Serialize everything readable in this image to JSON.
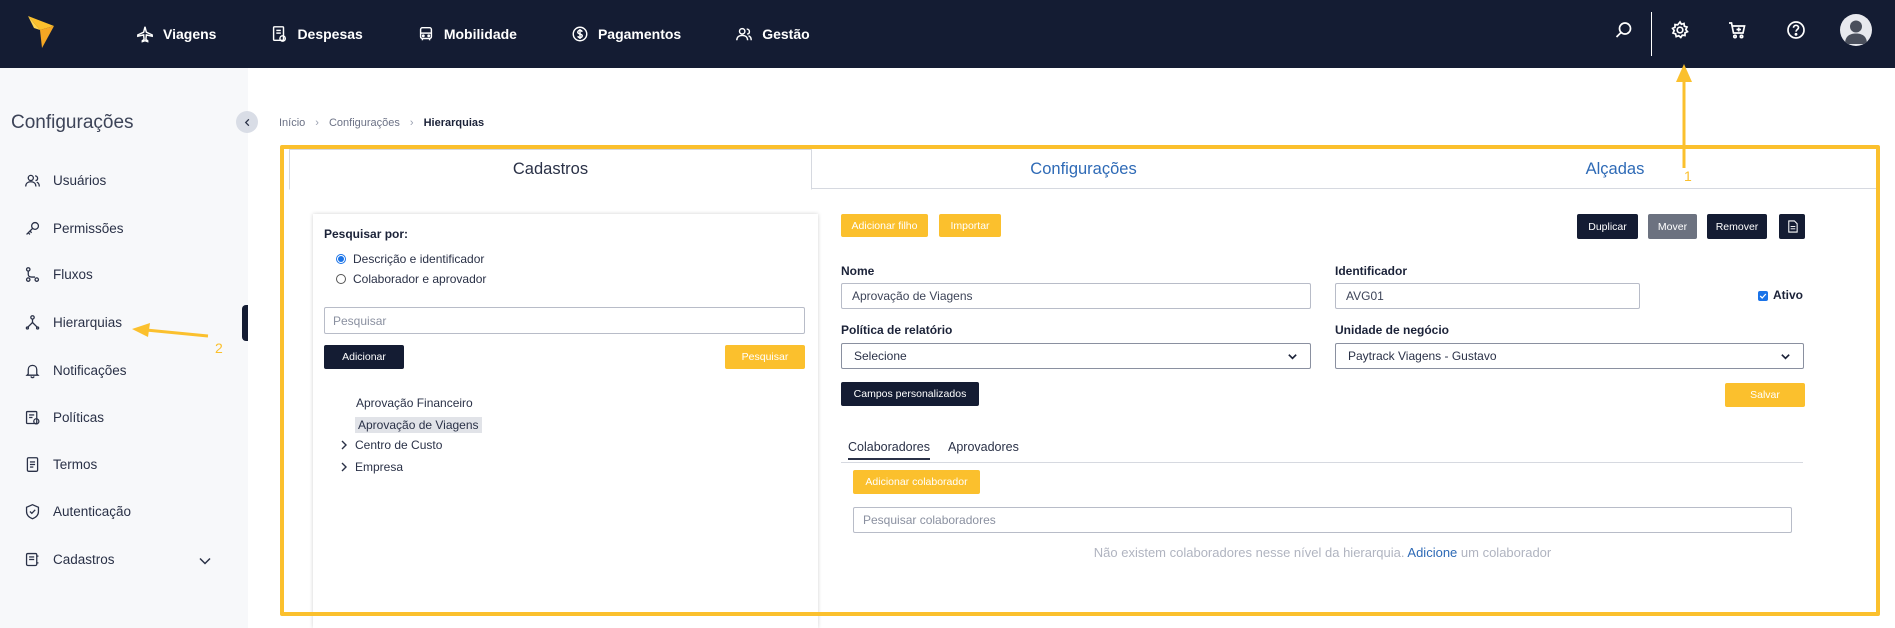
{
  "topnav": {
    "items": [
      {
        "label": "Viagens",
        "icon": "plane-icon"
      },
      {
        "label": "Despesas",
        "icon": "receipt-icon"
      },
      {
        "label": "Mobilidade",
        "icon": "bus-icon"
      },
      {
        "label": "Pagamentos",
        "icon": "dollar-icon"
      },
      {
        "label": "Gestão",
        "icon": "users-icon"
      }
    ]
  },
  "sidebar": {
    "title": "Configurações",
    "items": [
      {
        "label": "Usuários",
        "icon": "users-icon"
      },
      {
        "label": "Permissões",
        "icon": "key-icon"
      },
      {
        "label": "Fluxos",
        "icon": "flow-icon"
      },
      {
        "label": "Hierarquias",
        "icon": "hierarchy-icon"
      },
      {
        "label": "Notificações",
        "icon": "bell-icon"
      },
      {
        "label": "Políticas",
        "icon": "policy-icon"
      },
      {
        "label": "Termos",
        "icon": "document-icon"
      },
      {
        "label": "Autenticação",
        "icon": "shield-icon"
      },
      {
        "label": "Cadastros",
        "icon": "registry-icon"
      }
    ]
  },
  "breadcrumb": {
    "home": "Início",
    "parent": "Configurações",
    "current": "Hierarquias"
  },
  "tabs": {
    "cadastros": "Cadastros",
    "configuracoes": "Configurações",
    "alcadas": "Alçadas"
  },
  "search_panel": {
    "label": "Pesquisar por:",
    "option1": "Descrição e identificador",
    "option2": "Colaborador e aprovador",
    "placeholder": "Pesquisar",
    "add_label": "Adicionar",
    "search_label": "Pesquisar",
    "tree": [
      "Aprovação Financeiro",
      "Aprovação de Viagens",
      "Centro de Custo",
      "Empresa"
    ]
  },
  "toolbar": {
    "add_child": "Adicionar filho",
    "import": "Importar",
    "duplicate": "Duplicar",
    "move": "Mover",
    "remove": "Remover"
  },
  "form": {
    "name_label": "Nome",
    "name_value": "Aprovação de Viagens",
    "id_label": "Identificador",
    "id_value": "AVG01",
    "active_label": "Ativo",
    "policy_label": "Política de relatório",
    "policy_value": "Selecione",
    "unit_label": "Unidade de negócio",
    "unit_value": "Paytrack Viagens - Gustavo",
    "custom_fields": "Campos personalizados",
    "save": "Salvar"
  },
  "subtabs": {
    "collaborators": "Colaboradores",
    "approvers": "Aprovadores"
  },
  "collaborators": {
    "add_label": "Adicionar colaborador",
    "placeholder": "Pesquisar colaboradores",
    "empty_prefix": "Não existem colaboradores nesse nível da hierarquia.",
    "empty_link": "Adicione",
    "empty_suffix": "um colaborador"
  },
  "annotations": {
    "one": "1",
    "two": "2"
  },
  "colors": {
    "accent": "#fbc02d",
    "navy": "#141c33",
    "link": "#2e6ab6"
  }
}
